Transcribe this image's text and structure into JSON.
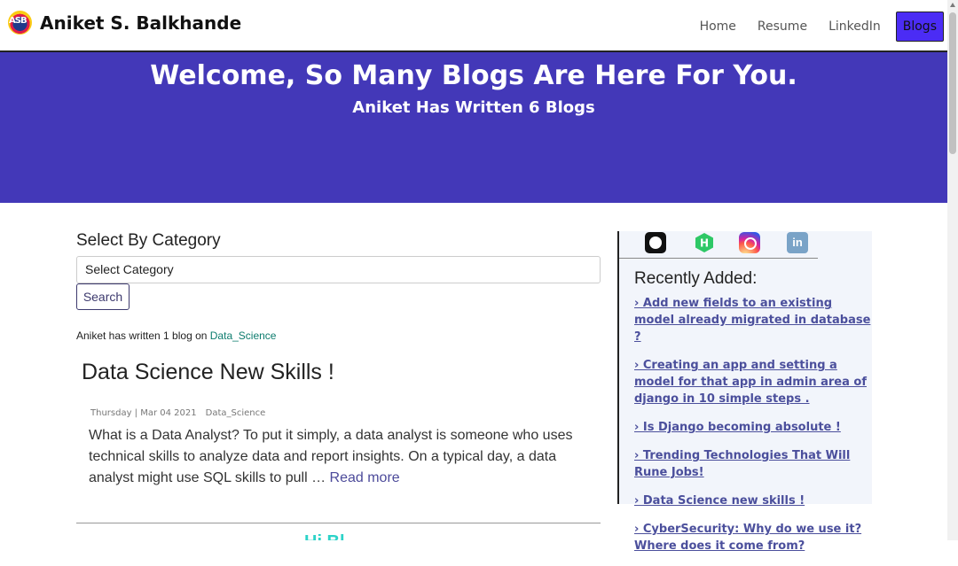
{
  "brand": {
    "name": "Aniket S. Balkhande",
    "logo_text": "ASB"
  },
  "nav": {
    "home": "Home",
    "resume": "Resume",
    "linkedin": "LinkedIn",
    "blogs": "Blogs"
  },
  "hero": {
    "title": "Welcome, So Many Blogs Are Here For You.",
    "subtitle": "Aniket Has Written 6 Blogs"
  },
  "filter": {
    "heading": "Select By Category",
    "select_value": "Select Category",
    "search_label": "Search",
    "count_prefix": "Aniket has written 1 blog on ",
    "count_category": "Data_Science"
  },
  "post": {
    "title": "Data Science New Skills !",
    "date": "Thursday | Mar 04 2021",
    "category": "Data_Science",
    "excerpt": "What is a Data Analyst? To put it simply, a data analyst is someone who uses technical skills to analyze data and report insights. On a typical day, a data analyst might use SQL skills to pull … ",
    "read_more": "Read more"
  },
  "next_post_peek": "Hi Bl",
  "sidebar": {
    "social_icons": [
      "github-icon",
      "hackerrank-icon",
      "instagram-icon",
      "linkedin-icon"
    ],
    "linkedin_glyph": "in",
    "hackerrank_glyph": "H",
    "recent_title": "Recently Added:",
    "recent": [
      "› Add new fields to an existing model already migrated in database ?",
      "› Creating an app and setting a model for that app in admin area of django in 10 simple steps .",
      "› Is Django becoming absolute !",
      "› Trending Technologies That Will Rune Jobs!",
      "› Data Science new skills !",
      "› CyberSecurity:  Why do we use it? Where does it come from?"
    ]
  },
  "colors": {
    "hero_bg": "#4338b8",
    "active_nav": "#4b2cf5",
    "link": "#4b4f9c",
    "category_link": "#0d7c6e"
  }
}
